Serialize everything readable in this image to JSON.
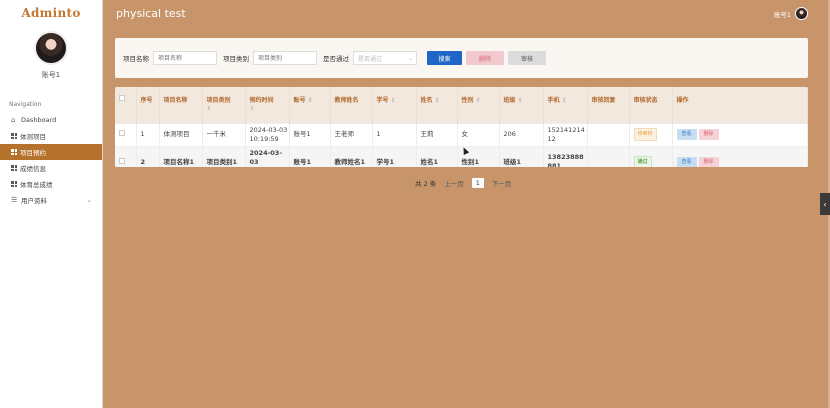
{
  "sidebar": {
    "logo": "Adminto",
    "user_name": "账号1",
    "nav_heading": "Navigation",
    "items": [
      {
        "label": "Dashboard",
        "icon": "home-icon"
      },
      {
        "label": "体测项目",
        "icon": "grid-icon"
      },
      {
        "label": "项目预约",
        "icon": "grid-icon",
        "active": true
      },
      {
        "label": "成绩信息",
        "icon": "grid-icon"
      },
      {
        "label": "体育总成绩",
        "icon": "grid-icon"
      },
      {
        "label": "用户资料",
        "icon": "list-icon",
        "chevron": "chevron-down-icon"
      }
    ]
  },
  "header": {
    "title": "physical test",
    "account": "账号1"
  },
  "search": {
    "project_name_label": "项目名称",
    "project_name_placeholder": "项目名称",
    "project_type_label": "项目类别",
    "project_type_placeholder": "项目类别",
    "passed_label": "是否通过",
    "passed_placeholder": "是否通过",
    "search_btn": "搜索",
    "delete_btn": "删除",
    "audit_btn": "审核"
  },
  "table": {
    "headers": {
      "index": "序号",
      "project_name": "项目名称",
      "project_type": "项目类别",
      "appointment_time": "预约时间",
      "account": "账号",
      "teacher_name": "教师姓名",
      "student_no": "学号",
      "name": "姓名",
      "gender": "性别",
      "class": "班级",
      "phone": "手机",
      "audit_reply": "审核回复",
      "audit_status": "审核状态",
      "actions": "操作",
      "sort_mark": "⇕"
    },
    "rows": [
      {
        "index": "1",
        "project_name": "体测项目",
        "project_type": "一千米",
        "appointment_time": "2024-03-03 10:19:59",
        "account": "账号1",
        "teacher_name": "王老师",
        "student_no": "1",
        "name": "王莉",
        "gender": "女",
        "class": "206",
        "phone": "15214121412",
        "audit_reply": "",
        "audit_status": "待审核",
        "view_btn": "查看",
        "delete_btn": "删除"
      },
      {
        "index": "2",
        "project_name": "项目名称1",
        "project_type": "项目类别1",
        "appointment_time": "2024-03-03 10:00:34",
        "account": "账号1",
        "teacher_name": "教师姓名1",
        "student_no": "学号1",
        "name": "姓名1",
        "gender": "性别1",
        "class": "班级1",
        "phone": "13823888881",
        "audit_reply": "",
        "audit_status": "通过",
        "view_btn": "查看",
        "delete_btn": "删除"
      }
    ]
  },
  "pagination": {
    "total": "共 2 条",
    "prev": "上一页",
    "current": "1",
    "next": "下一页"
  },
  "colors": {
    "accent": "#b5722d",
    "background": "#c8956a",
    "primary_button": "#1f66c6"
  }
}
